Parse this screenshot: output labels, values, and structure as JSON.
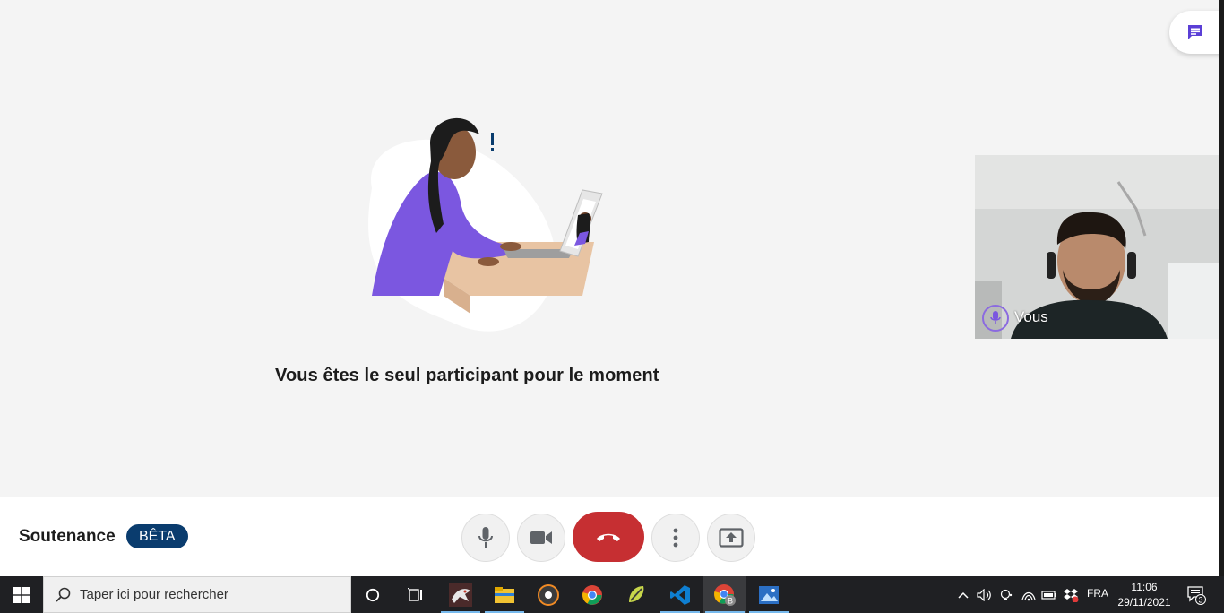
{
  "stage": {
    "alone_message": "Vous êtes le seul participant pour le moment",
    "self_view_name": "Vous"
  },
  "controls": {
    "meeting_name": "Soutenance",
    "beta_badge": "BÊTA",
    "icons": [
      "microphone-icon",
      "camera-icon",
      "hang-up-icon",
      "more-options-icon",
      "share-screen-icon"
    ],
    "colors": {
      "hangup": "#c62f32",
      "badge": "#0a3c6e",
      "accent": "#5b3fd6"
    }
  },
  "taskbar": {
    "search_placeholder": "Taper ici pour rechercher",
    "language": "FRA",
    "time": "11:06",
    "date": "29/11/2021",
    "notifications_count": "3",
    "apps": [
      "cortana-icon",
      "task-view-icon",
      "app-dragon-icon",
      "file-explorer-icon",
      "media-player-icon",
      "chrome-icon",
      "winrar-icon",
      "vscode-icon",
      "chrome-profile-icon",
      "photos-icon"
    ]
  }
}
